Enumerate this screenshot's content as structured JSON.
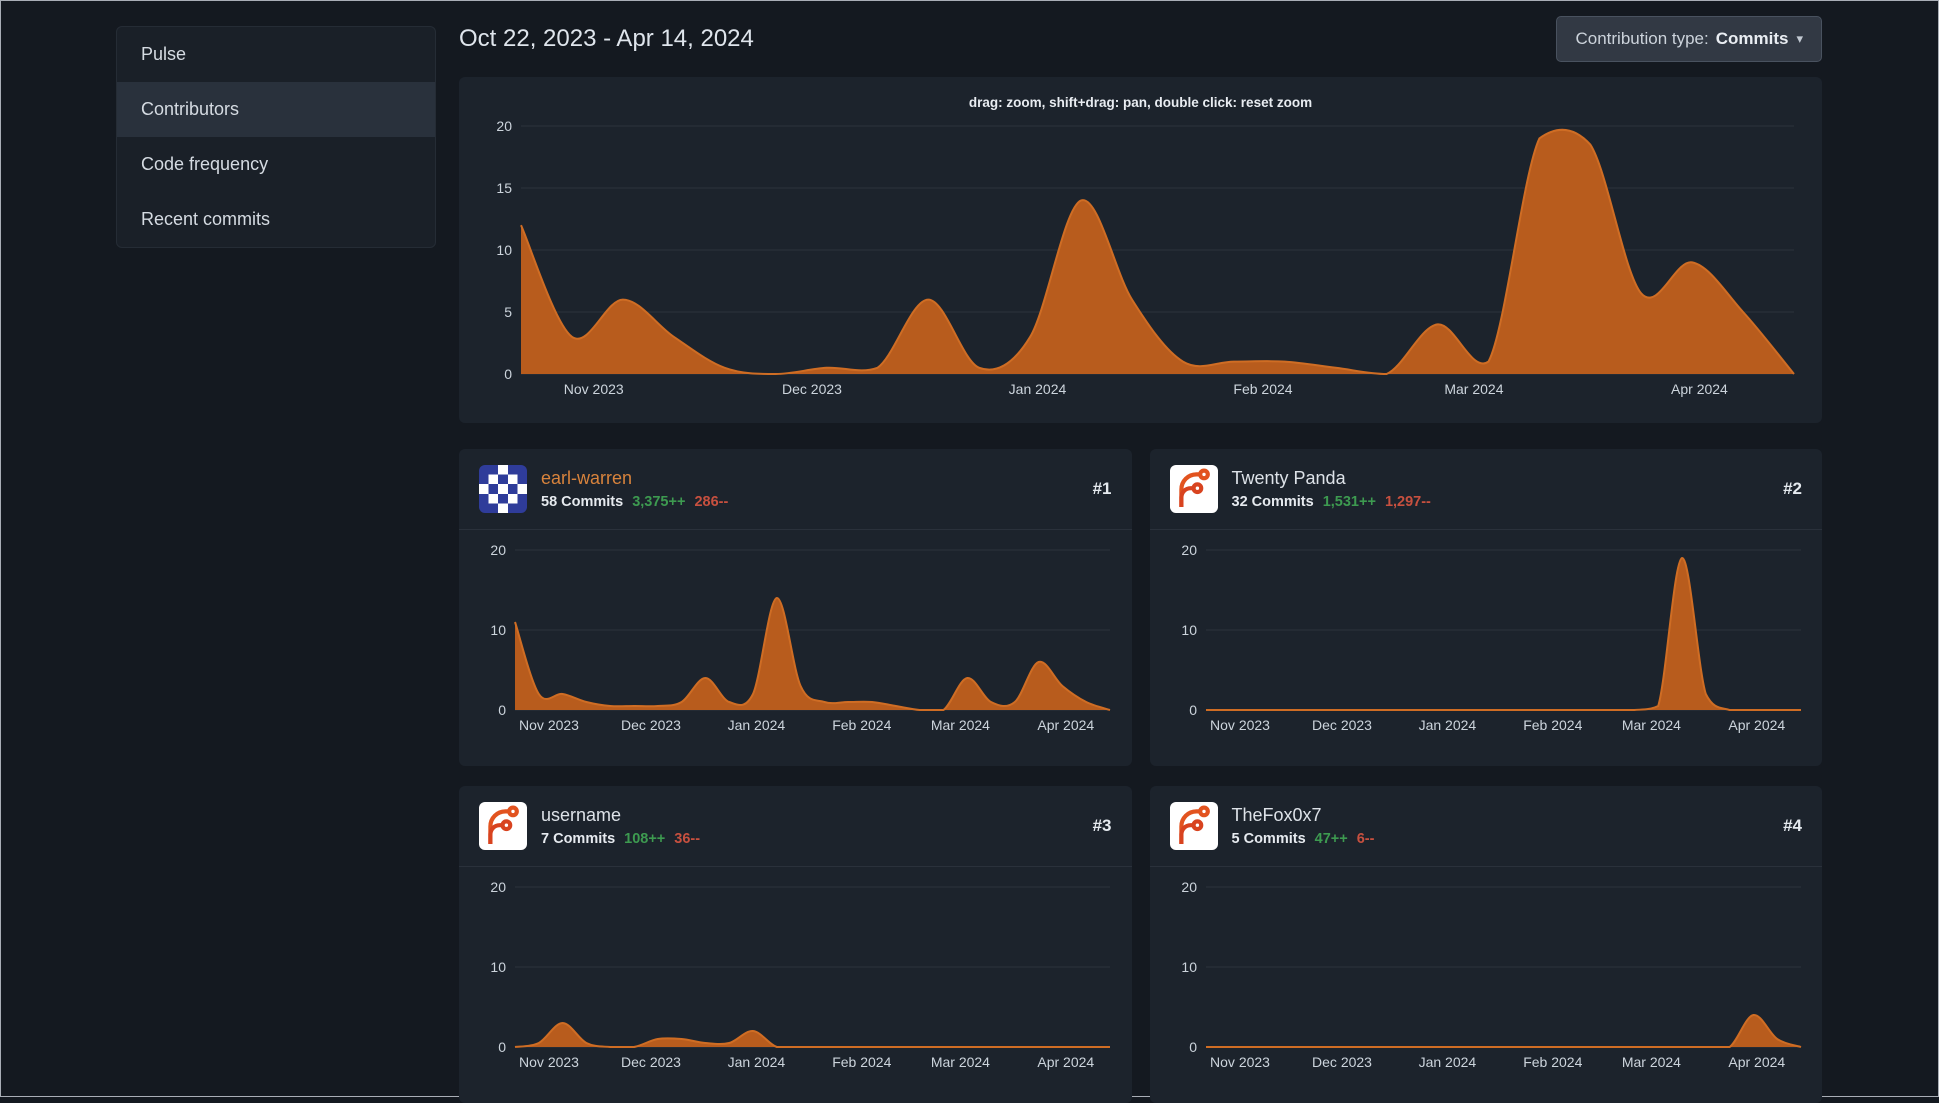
{
  "colors": {
    "page_bg": "#141920",
    "panel_bg": "#1c232c",
    "menu_bg": "#1a2028",
    "menu_active": "#29313c",
    "text": "#d3dae2",
    "axis_text": "#ccd4dc",
    "grid": "#2b333d",
    "area_orange": "#b85c1d",
    "line_orange": "#cf6d24",
    "green": "#3d9a50",
    "red": "#c7503f",
    "link_orange": "#d8833c",
    "name_text": "#dde2e8",
    "button_bg": "#323944",
    "button_border": "#49525f"
  },
  "icons": {
    "chevron_down": "▾"
  },
  "sidebar": {
    "items": [
      {
        "label": "Pulse",
        "active": false
      },
      {
        "label": "Contributors",
        "active": true
      },
      {
        "label": "Code frequency",
        "active": false
      },
      {
        "label": "Recent commits",
        "active": false
      }
    ]
  },
  "header": {
    "date_range": "Oct 22, 2023 - Apr 14, 2024",
    "contribution_type_label": "Contribution type:",
    "contribution_type_value": "Commits"
  },
  "overview": {
    "hint": "drag: zoom, shift+drag: pan, double click: reset zoom"
  },
  "contributors": [
    {
      "rank": "#1",
      "name": "earl-warren",
      "commits": "58 Commits",
      "additions": "3,375++",
      "deletions": "286--"
    },
    {
      "rank": "#2",
      "name": "Twenty Panda",
      "commits": "32 Commits",
      "additions": "1,531++",
      "deletions": "1,297--"
    },
    {
      "rank": "#3",
      "name": "username",
      "commits": "7 Commits",
      "additions": "108++",
      "deletions": "36--"
    },
    {
      "rank": "#4",
      "name": "TheFox0x7",
      "commits": "5 Commits",
      "additions": "47++",
      "deletions": "6--"
    }
  ],
  "chart_data": {
    "type": "area",
    "start": "2023-10-22",
    "end": "2024-04-14",
    "ylim": [
      0,
      20
    ],
    "grid": true,
    "weeks": [
      "2023-10-22",
      "2023-10-29",
      "2023-11-05",
      "2023-11-12",
      "2023-11-19",
      "2023-11-26",
      "2023-12-03",
      "2023-12-10",
      "2023-12-17",
      "2023-12-24",
      "2023-12-31",
      "2024-01-07",
      "2024-01-14",
      "2024-01-21",
      "2024-01-28",
      "2024-02-04",
      "2024-02-11",
      "2024-02-18",
      "2024-02-25",
      "2024-03-03",
      "2024-03-10",
      "2024-03-17",
      "2024-03-24",
      "2024-03-31",
      "2024-04-07",
      "2024-04-14"
    ],
    "xticks": [
      {
        "label": "Nov 2023",
        "date": "2023-11-01"
      },
      {
        "label": "Dec 2023",
        "date": "2023-12-01"
      },
      {
        "label": "Jan 2024",
        "date": "2024-01-01"
      },
      {
        "label": "Feb 2024",
        "date": "2024-02-01"
      },
      {
        "label": "Mar 2024",
        "date": "2024-03-01"
      },
      {
        "label": "Apr 2024",
        "date": "2024-04-01"
      }
    ],
    "charts": [
      {
        "id": "overview",
        "title": "All contributors commits per week",
        "yticks": [
          0,
          5,
          10,
          15,
          20
        ],
        "values": [
          12,
          3,
          6,
          3,
          0.5,
          0,
          0.5,
          0.5,
          6,
          0.5,
          3,
          14,
          6,
          1,
          1,
          1,
          0.5,
          0,
          4,
          1,
          19,
          18.5,
          6.5,
          9,
          5,
          0
        ]
      },
      {
        "id": "c1",
        "title": "earl-warren commits per week",
        "yticks": [
          0,
          10,
          20
        ],
        "values": [
          11,
          2,
          2,
          1,
          0.5,
          0.5,
          0.5,
          1,
          4,
          1,
          2,
          14,
          3,
          1,
          1,
          1,
          0.5,
          0,
          0,
          4,
          1,
          1,
          6,
          3,
          1,
          0
        ]
      },
      {
        "id": "c2",
        "title": "Twenty Panda commits per week",
        "yticks": [
          0,
          10,
          20
        ],
        "values": [
          0,
          0,
          0,
          0,
          0,
          0,
          0,
          0,
          0,
          0,
          0,
          0,
          0,
          0,
          0,
          0,
          0,
          0,
          0,
          0.5,
          19,
          2,
          0,
          0,
          0,
          0
        ]
      },
      {
        "id": "c3",
        "title": "username commits per week",
        "yticks": [
          0,
          10,
          20
        ],
        "values": [
          0,
          0.5,
          3,
          0.5,
          0,
          0,
          1,
          1,
          0.5,
          0.5,
          2,
          0,
          0,
          0,
          0,
          0,
          0,
          0,
          0,
          0,
          0,
          0,
          0,
          0,
          0,
          0
        ]
      },
      {
        "id": "c4",
        "title": "TheFox0x7 commits per week",
        "yticks": [
          0,
          10,
          20
        ],
        "values": [
          0,
          0,
          0,
          0,
          0,
          0,
          0,
          0,
          0,
          0,
          0,
          0,
          0,
          0,
          0,
          0,
          0,
          0,
          0,
          0,
          0,
          0,
          0,
          4,
          1,
          0
        ]
      }
    ]
  }
}
